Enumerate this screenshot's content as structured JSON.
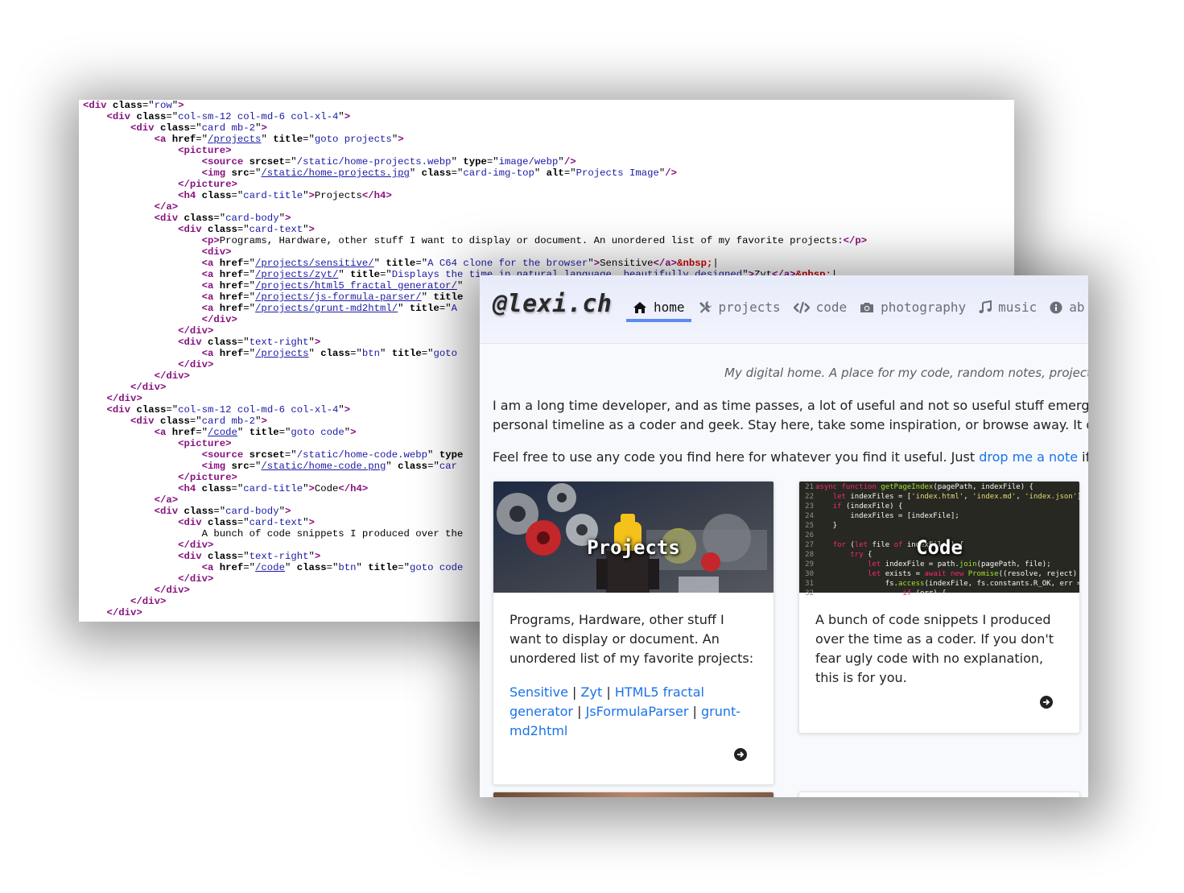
{
  "source_view": {
    "lines": [
      "<div class=\"row\">",
      "    <div class=\"col-sm-12 col-md-6 col-xl-4\">",
      "        <div class=\"card mb-2\">",
      "            <a href=\"/projects\" title=\"goto projects\" >",
      "                <picture>",
      "                    <source srcset=\"/static/home-projects.webp\" type=\"image/webp\"/>",
      "                    <img src=\"/static/home-projects.jpg\" class=\"card-img-top\" alt=\"Projects Image\" />",
      "                </picture>",
      "                <h4 class=\"card-title\">Projects</h4>",
      "            </a>",
      "            <div class=\"card-body\">",
      "                <div class=\"card-text\">",
      "                    <p>Programs, Hardware, other stuff I want to display or document. An unordered list of my favorite projects:</p>",
      "                    <div>",
      "                    <a href=\"/projects/sensitive/\" title=\"A C64 clone for the browser\">Sensitive</a>&nbsp;|",
      "                    <a href=\"/projects/zyt/\" title=\"Displays the time in natural language, beautifully designed\">Zyt</a>&nbsp;|",
      "                    <a href=\"/projects/html5 fractal generator/\"",
      "                    <a href=\"/projects/js-formula-parser/\" title",
      "                    <a href=\"/projects/grunt-md2html/\" title=\"A",
      "                    </div>",
      "                </div>",
      "                <div class=\"text-right\">",
      "                    <a href=\"/projects\" class=\"btn\" title=\"goto",
      "                </div>",
      "            </div>",
      "        </div>",
      "    </div>",
      "    <div class=\"col-sm-12 col-md-6 col-xl-4\">",
      "        <div class=\"card mb-2\">",
      "            <a href=\"/code\" title=\"goto code\">",
      "                <picture>",
      "                    <source srcset=\"/static/home-code.webp\" type",
      "                    <img src=\"/static/home-code.png\" class=\"car",
      "                </picture>",
      "                <h4 class=\"card-title\">Code</h4>",
      "            </a>",
      "            <div class=\"card-body\">",
      "                <div class=\"card-text\">",
      "                    A bunch of code snippets I produced over the",
      "                </div>",
      "                <div class=\"text-right\">",
      "                    <a href=\"/code\" class=\"btn\" title=\"goto code",
      "                </div>",
      "            </div>",
      "        </div>",
      "    </div>"
    ]
  },
  "site": {
    "brand": "@lexi.ch",
    "nav": [
      {
        "label": "home",
        "icon": "home-icon",
        "active": true
      },
      {
        "label": "projects",
        "icon": "tools-icon",
        "active": false
      },
      {
        "label": "code",
        "icon": "code-icon",
        "active": false
      },
      {
        "label": "photography",
        "icon": "camera-icon",
        "active": false
      },
      {
        "label": "music",
        "icon": "music-note-icon",
        "active": false
      },
      {
        "label": "ab",
        "icon": "info-icon",
        "active": false
      }
    ],
    "tagline": "My digital home. A place for my code, random notes, projects, ra",
    "intro_line1": "I am a long time developer, and as time passes, a lot of useful and not so useful stuff emerged from",
    "intro_line2": "personal timeline as a coder and geek. Stay here, take some inspiration, or browse away. It doesn't l",
    "feel_free_before": "Feel free to use any code you find here for whatever you find it useful. Just ",
    "feel_free_link": "drop me a note",
    "feel_free_after": " if you do",
    "cards": {
      "projects": {
        "title": "Projects",
        "text": "Programs, Hardware, other stuff I want to display or document. An unordered list of my favorite projects:",
        "links": [
          "Sensitive",
          "Zyt",
          "HTML5 fractal generator",
          "JsFormulaParser",
          "grunt-md2html"
        ],
        "separator": "|"
      },
      "code": {
        "title": "Code",
        "text": "A bunch of code snippets I produced over the time as a coder. If you don't fear ugly code with no explanation, this is for you."
      }
    }
  },
  "code_thumbnail": {
    "line_numbers": [
      "21",
      "22",
      "23",
      "24",
      "25",
      "26",
      "27",
      "28",
      "29",
      "30",
      "31",
      "32"
    ],
    "lines": [
      "async function getPageIndex(pagePath, indexFile) {",
      "    let indexFiles = ['index.html', 'index.md', 'index.json'];",
      "    if (indexFile) {",
      "        indexFiles = [indexFile];",
      "    }",
      "",
      "    for (let file of indexFiles) {",
      "        try {",
      "            let indexFile = path.join(pagePath, file);",
      "            let exists = await new Promise((resolve, reject) => {",
      "                fs.access(indexFile, fs.constants.R_OK, err => {",
      "                    if (err) {"
    ]
  },
  "colors": {
    "accent": "#5b8af0",
    "link": "#1a73e8",
    "tag": "#881280",
    "attr_value": "#1a1aa6"
  }
}
